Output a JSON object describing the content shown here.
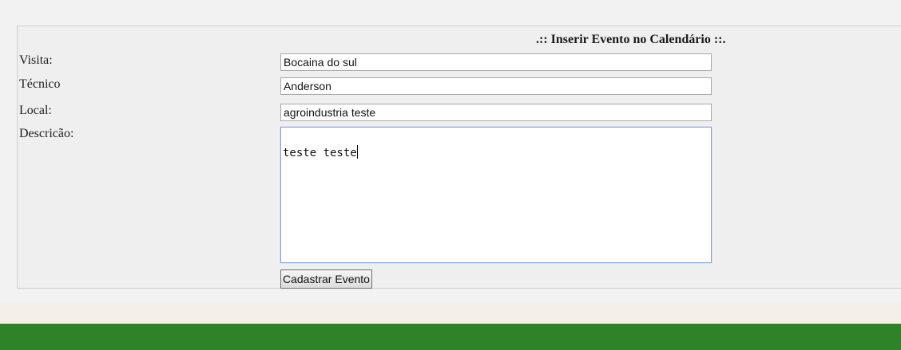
{
  "form": {
    "title": ".:: Inserir Evento no Calendário ::.",
    "fields": {
      "visita": {
        "label": "Visita:",
        "value": "Bocaina do sul"
      },
      "tecnico": {
        "label": "Técnico",
        "value": "Anderson"
      },
      "local": {
        "label": "Local:",
        "value": "agroindustria teste"
      },
      "descricao": {
        "label": "Descricão:",
        "value": "teste teste"
      }
    },
    "submit_label": "Cadastrar Evento"
  },
  "colors": {
    "footer": "#2e8329",
    "page_background": "#f2f2f2",
    "focus_border": "#7fa1d6"
  }
}
